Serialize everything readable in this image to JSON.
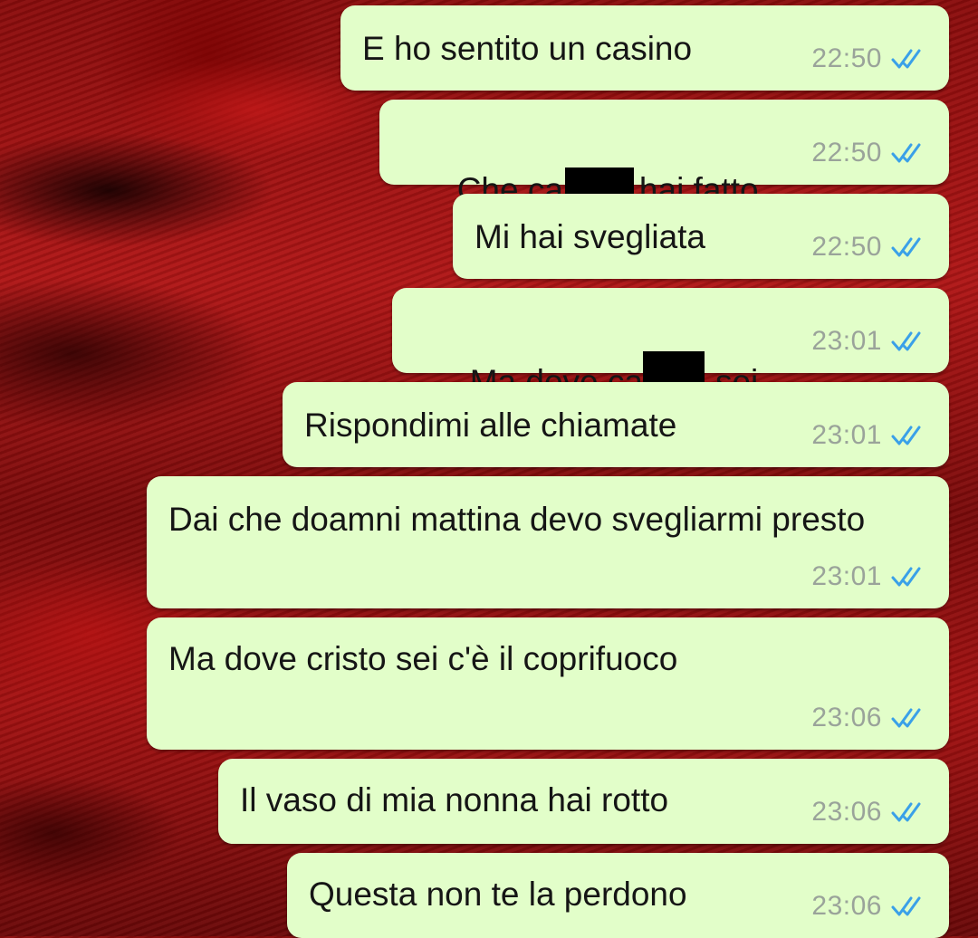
{
  "chat": {
    "messages": [
      {
        "text": "E ho sentito un casino",
        "time": "22:50"
      },
      {
        "text_before": "Che ca",
        "text_after": "hai fatto",
        "time": "22:50"
      },
      {
        "text": "Mi hai svegliata",
        "time": "22:50"
      },
      {
        "text_before": "Ma dove ca",
        "text_after": "sei",
        "time": "23:01"
      },
      {
        "text": "Rispondimi alle chiamate",
        "time": "23:01"
      },
      {
        "text": "Dai che doamni mattina devo svegliarmi presto",
        "time": "23:01"
      },
      {
        "text": "Ma dove cristo sei c'è il coprifuoco",
        "time": "23:06"
      },
      {
        "text": "Il vaso di mia nonna hai rotto",
        "time": "23:06"
      },
      {
        "text": "Questa non te la perdono",
        "time": "23:06"
      }
    ],
    "status_icon": "double-check-read-icon",
    "colors": {
      "bubble_background": "#e2fec9",
      "read_ticks": "#3aa0e8",
      "timestamp": "#9aa39a",
      "wallpaper": "#a51212"
    }
  }
}
